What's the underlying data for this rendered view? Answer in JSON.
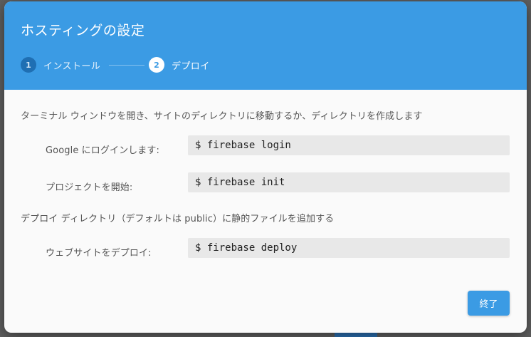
{
  "dialog": {
    "title": "ホスティングの設定",
    "steps": [
      {
        "number": "1",
        "label": "インストール"
      },
      {
        "number": "2",
        "label": "デプロイ"
      }
    ],
    "intro_text": "ターミナル ウィンドウを開き、サイトのディレクトリに移動するか、ディレクトリを作成します",
    "rows": [
      {
        "label": "Google にログインします:",
        "command": "$ firebase login"
      },
      {
        "label": "プロジェクトを開始:",
        "command": "$ firebase init"
      }
    ],
    "deploy_text": "デプロイ ディレクトリ（デフォルトは public）に静的ファイルを追加する",
    "deploy_row": {
      "label": "ウェブサイトをデプロイ:",
      "command": "$ firebase deploy"
    },
    "done_label": "終了"
  },
  "colors": {
    "header": "#3b9be4",
    "button": "#3b9be4",
    "code_bg": "#e8e8e8"
  }
}
